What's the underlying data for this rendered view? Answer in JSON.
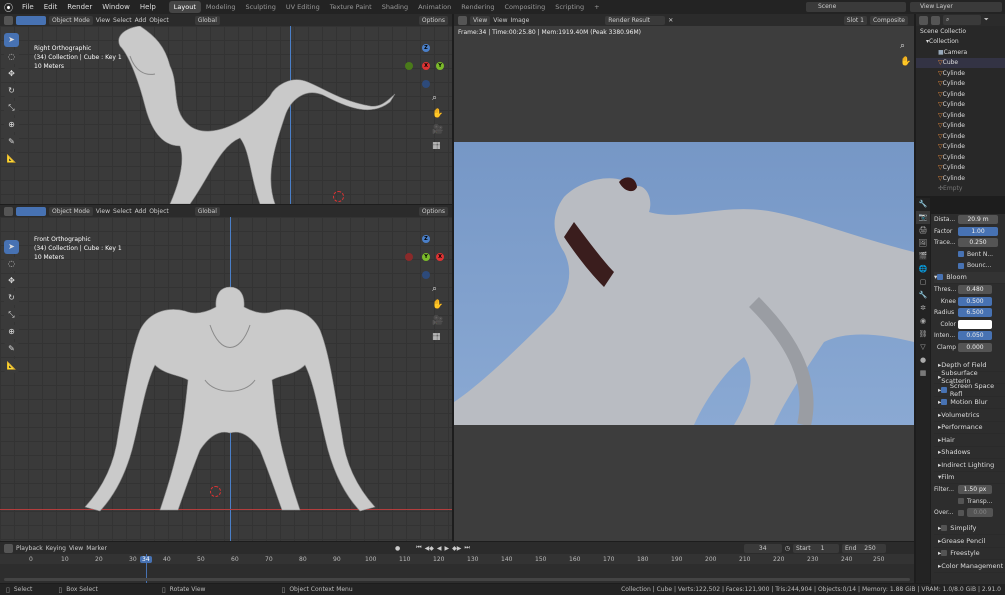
{
  "app_menu": [
    "File",
    "Edit",
    "Render",
    "Window",
    "Help"
  ],
  "workspaces": [
    "Layout",
    "Modeling",
    "Sculpting",
    "UV Editing",
    "Texture Paint",
    "Shading",
    "Animation",
    "Rendering",
    "Compositing",
    "Scripting",
    "+"
  ],
  "scene_label": "Scene",
  "view_layer_label": "View Layer",
  "viewport_top": {
    "mode": "Object Mode",
    "menus": [
      "View",
      "Select",
      "Add",
      "Object"
    ],
    "transform": "Global",
    "options": "Options",
    "title": "Right Orthographic",
    "info": "(34) Collection | Cube : Key 1",
    "scale": "10 Meters"
  },
  "viewport_bottom": {
    "mode": "Object Mode",
    "menus": [
      "View",
      "Select",
      "Add",
      "Object"
    ],
    "transform": "Global",
    "options": "Options",
    "title": "Front Orthographic",
    "info": "(34) Collection | Cube : Key 1",
    "scale": "10 Meters"
  },
  "gizmo_axes": [
    "Z",
    "Y",
    "X"
  ],
  "image_editor": {
    "menus": [
      "View",
      "View",
      "Image"
    ],
    "image_name": "Render Result",
    "slot": "Slot 1",
    "pass": "Composite",
    "frame_info": "Frame:34 | Time:00:25.80 | Mem:1919.40M (Peak 3380.96M)"
  },
  "outliner": {
    "root": "Scene Collectio",
    "items": [
      "Collection",
      "Camera",
      "Cube",
      "Cylinde",
      "Cylinde",
      "Cylinde",
      "Cylinde",
      "Cylinde",
      "Cylinde",
      "Cylinde",
      "Cylinde",
      "Cylinde",
      "Cylinde",
      "Cylinde",
      "Empty"
    ]
  },
  "properties": {
    "fields": [
      {
        "label": "Dista...",
        "value": "20.9 m",
        "style": "plain"
      },
      {
        "label": "Factor",
        "value": "1.00",
        "style": "blue"
      },
      {
        "label": "Trace...",
        "value": "0.250",
        "style": "plain"
      }
    ],
    "checks": [
      "Bent N...",
      "Bounc..."
    ],
    "bloom_label": "Bloom",
    "bloom_fields": [
      {
        "label": "Thres...",
        "value": "0.480",
        "style": "plain"
      },
      {
        "label": "Knee",
        "value": "0.500",
        "style": "blue"
      },
      {
        "label": "Radius",
        "value": "6.500",
        "style": "blue"
      },
      {
        "label": "Color",
        "value": "",
        "style": "white"
      },
      {
        "label": "Inten...",
        "value": "0.050",
        "style": "blue"
      },
      {
        "label": "Clamp",
        "value": "0.000",
        "style": "plain"
      }
    ],
    "sections": [
      {
        "label": "Depth of Field",
        "check": false,
        "hascheck": false
      },
      {
        "label": "Subsurface Scatterin",
        "check": false,
        "hascheck": false
      },
      {
        "label": "Screen Space Refl",
        "check": true,
        "hascheck": true
      },
      {
        "label": "Motion Blur",
        "check": true,
        "hascheck": true
      },
      {
        "label": "Volumetrics",
        "check": false,
        "hascheck": false
      },
      {
        "label": "Performance",
        "check": false,
        "hascheck": false
      },
      {
        "label": "Hair",
        "check": false,
        "hascheck": false
      },
      {
        "label": "Shadows",
        "check": false,
        "hascheck": false
      },
      {
        "label": "Indirect Lighting",
        "check": false,
        "hascheck": false
      }
    ],
    "film_label": "Film",
    "film_filter_label": "Filter...",
    "film_filter_value": "1.50 px",
    "film_transp": "Transp...",
    "film_over": "Over...",
    "film_over_value": "0.00",
    "bottom_sections": [
      {
        "label": "Simplify",
        "hascheck": true
      },
      {
        "label": "Grease Pencil",
        "hascheck": false
      },
      {
        "label": "Freestyle",
        "hascheck": true
      },
      {
        "label": "Color Management",
        "hascheck": false
      }
    ]
  },
  "timeline": {
    "menus": [
      "Playback",
      "Keying",
      "View",
      "Marker"
    ],
    "current_frame": "34",
    "start_label": "Start",
    "start": "1",
    "end_label": "End",
    "end": "250",
    "ticks": [
      "0",
      "10",
      "20",
      "30",
      "34",
      "40",
      "50",
      "60",
      "70",
      "80",
      "90",
      "100",
      "110",
      "120",
      "130",
      "140",
      "150",
      "160",
      "170",
      "180",
      "190",
      "200",
      "210",
      "220",
      "230",
      "240",
      "250"
    ]
  },
  "statusbar": {
    "hints": [
      "Select",
      "Box Select",
      "Rotate View",
      "Object Context Menu"
    ],
    "stats": "Collection | Cube | Verts:122,502 | Faces:121,900 | Tris:244,904 | Objects:0/14 | Memory: 1.88 GiB | VRAM: 1.0/8.0 GiB | 2.91.0"
  },
  "colors": {
    "accent": "#4772b3",
    "sky": "#7f9fca",
    "grid_axis_blue": "#4a7fc8",
    "grid_axis_red": "#b33d3d"
  }
}
